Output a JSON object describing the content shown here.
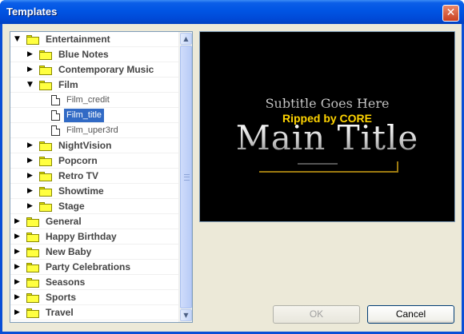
{
  "window": {
    "title": "Templates",
    "close_glyph": "✕"
  },
  "tree": {
    "items": [
      {
        "label": "Entertainment",
        "type": "folder",
        "level": 0,
        "state": "expanded"
      },
      {
        "label": "Blue Notes",
        "type": "folder",
        "level": 1,
        "state": "collapsed"
      },
      {
        "label": "Contemporary Music",
        "type": "folder",
        "level": 1,
        "state": "collapsed"
      },
      {
        "label": "Film",
        "type": "folder",
        "level": 1,
        "state": "expanded"
      },
      {
        "label": "Film_credit",
        "type": "file",
        "level": 2
      },
      {
        "label": "Film_title",
        "type": "file",
        "level": 2,
        "selected": true
      },
      {
        "label": "Film_uper3rd",
        "type": "file",
        "level": 2
      },
      {
        "label": "NightVision",
        "type": "folder",
        "level": 1,
        "state": "collapsed"
      },
      {
        "label": "Popcorn",
        "type": "folder",
        "level": 1,
        "state": "collapsed"
      },
      {
        "label": "Retro TV",
        "type": "folder",
        "level": 1,
        "state": "collapsed"
      },
      {
        "label": "Showtime",
        "type": "folder",
        "level": 1,
        "state": "collapsed"
      },
      {
        "label": "Stage",
        "type": "folder",
        "level": 1,
        "state": "collapsed"
      },
      {
        "label": "General",
        "type": "folder",
        "level": 0,
        "state": "collapsed"
      },
      {
        "label": "Happy Birthday",
        "type": "folder",
        "level": 0,
        "state": "collapsed"
      },
      {
        "label": "New Baby",
        "type": "folder",
        "level": 0,
        "state": "collapsed"
      },
      {
        "label": "Party Celebrations",
        "type": "folder",
        "level": 0,
        "state": "collapsed"
      },
      {
        "label": "Seasons",
        "type": "folder",
        "level": 0,
        "state": "collapsed"
      },
      {
        "label": "Sports",
        "type": "folder",
        "level": 0,
        "state": "collapsed"
      },
      {
        "label": "Travel",
        "type": "folder",
        "level": 0,
        "state": "collapsed"
      }
    ],
    "scroll_up_glyph": "▲",
    "scroll_down_glyph": "▼"
  },
  "preview": {
    "subtitle": "Subtitle Goes Here",
    "watermark": "Ripped by CORE",
    "main_title": "Main Title"
  },
  "buttons": {
    "ok_label": "OK",
    "cancel_label": "Cancel"
  },
  "colors": {
    "titlebar": "#0054e3",
    "selection": "#316ac5",
    "dialog_bg": "#ece9d8",
    "watermark": "#ffd400"
  }
}
